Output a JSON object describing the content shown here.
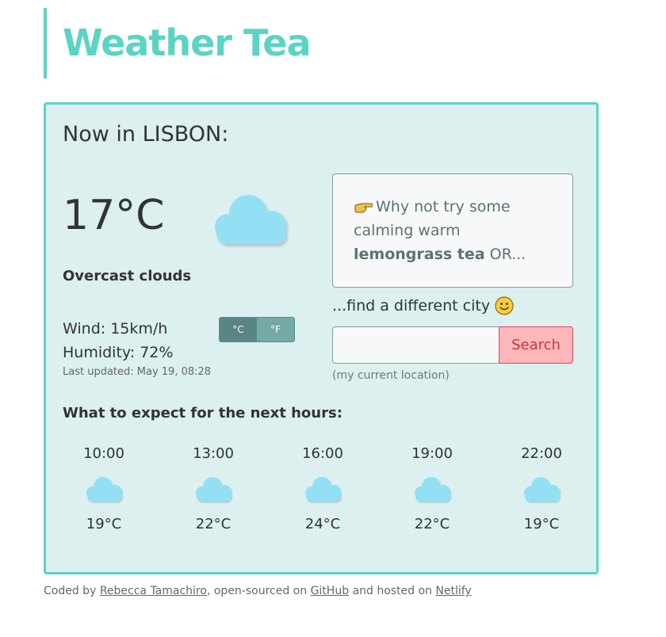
{
  "app": {
    "title": "Weather Tea"
  },
  "current": {
    "heading": "Now in LISBON:",
    "temperature": "17°C",
    "description": "Overcast clouds",
    "wind": "Wind: 15km/h",
    "humidity": "Humidity: 72%",
    "last_updated": "Last updated: May 19, 08:28",
    "icon": "cloud-icon"
  },
  "units": {
    "celsius": "°C",
    "fahrenheit": "°F",
    "selected": "celsius"
  },
  "tea": {
    "prefix": "Why not try some calming warm ",
    "tea_name": "lemongrass tea",
    "suffix": " OR...",
    "icon": "pointing-hand-icon"
  },
  "search": {
    "prompt": "...find a different city",
    "placeholder": "",
    "value": "",
    "button_label": "Search",
    "current_location_link": "(my current location)"
  },
  "forecast": {
    "heading": "What to expect for the next hours:",
    "items": [
      {
        "time": "10:00",
        "temp": "19°C",
        "icon": "cloud-icon"
      },
      {
        "time": "13:00",
        "temp": "22°C",
        "icon": "cloud-icon"
      },
      {
        "time": "16:00",
        "temp": "24°C",
        "icon": "cloud-icon"
      },
      {
        "time": "19:00",
        "temp": "22°C",
        "icon": "cloud-icon"
      },
      {
        "time": "22:00",
        "temp": "19°C",
        "icon": "cloud-icon"
      }
    ]
  },
  "footer": {
    "prefix": "Coded by ",
    "author": "Rebecca Tamachiro",
    "middle": ", open-sourced on ",
    "github": "GitHub",
    "middle2": " and hosted on ",
    "netlify": "Netlify"
  },
  "colors": {
    "accent": "#5ad4c4",
    "card_bg": "#dbf0ef",
    "cloud": "#93e0f4",
    "search_button_bg": "#fdb7bb",
    "search_button_text": "#c9353f"
  }
}
